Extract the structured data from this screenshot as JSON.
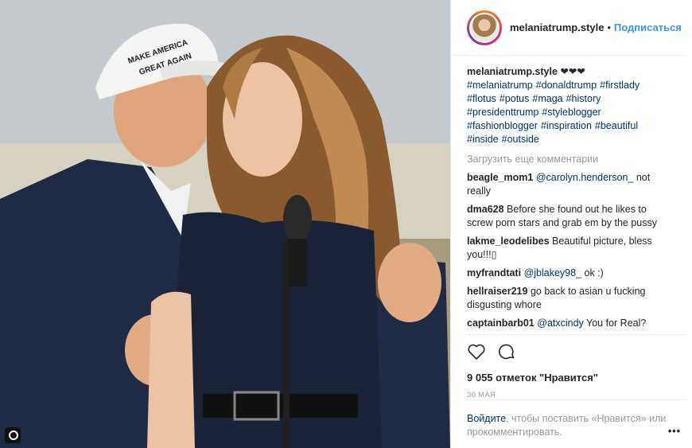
{
  "post": {
    "username": "melaniatrump.style",
    "follow_label": "Подписаться",
    "caption_hearts": "❤❤❤",
    "hashtags": [
      "#melaniatrump",
      "#donaldtrump",
      "#firstlady",
      "#flotus",
      "#potus",
      "#maga",
      "#history",
      "#presidenttrump",
      "#styleblogger",
      "#fashionblogger",
      "#inspiration",
      "#beautiful",
      "#inside",
      "#outside"
    ],
    "cap_text": "MAKE AMERICA GREAT AGAIN",
    "load_more": "Загрузить еще комментарии",
    "comments": [
      {
        "user": "beagle_mom1",
        "mention": "@carolyn.henderson_",
        "text": " not really"
      },
      {
        "user": "dma628",
        "mention": "",
        "text": "Before she found out he likes to screw porn stars and grab em by the pussy"
      },
      {
        "user": "lakme_leodelibes",
        "mention": "",
        "text": "Beautiful picture, bless you!!!▯"
      },
      {
        "user": "myfrandtati",
        "mention": "@jblakey98_",
        "text": " ok :)"
      },
      {
        "user": "hellraiser219",
        "mention": "",
        "text": "go back to asian u fucking disgusting whore"
      },
      {
        "user": "captainbarb01",
        "mention": "@atxcindy",
        "text": " You for Real?"
      }
    ],
    "likes": "9 055 отметок \"Нравится\"",
    "date": "30 мая",
    "footer_login": "Войдите",
    "footer_text": ", чтобы поставить «Нравится» или прокомментировать.",
    "more": "•••"
  },
  "icons": [
    "heart-icon",
    "comment-icon",
    "carousel-icon",
    "more-icon"
  ],
  "colors": {
    "link": "#3897f0",
    "hashtag": "#003569",
    "muted": "#999999",
    "text": "#262626"
  }
}
